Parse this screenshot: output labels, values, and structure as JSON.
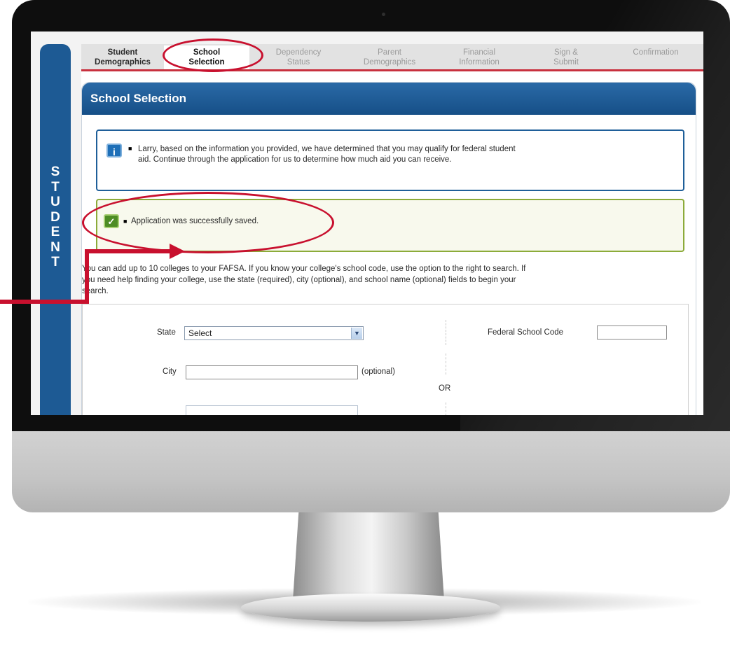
{
  "student_sidebar": {
    "letters": [
      "S",
      "T",
      "U",
      "D",
      "E",
      "N",
      "T"
    ]
  },
  "tabs": [
    {
      "line1": "Student",
      "line2": "Demographics",
      "state": "done"
    },
    {
      "line1": "School",
      "line2": "Selection",
      "state": "active"
    },
    {
      "line1": "Dependency",
      "line2": "Status",
      "state": "future"
    },
    {
      "line1": "Parent",
      "line2": "Demographics",
      "state": "future"
    },
    {
      "line1": "Financial",
      "line2": "Information",
      "state": "future"
    },
    {
      "line1": "Sign &",
      "line2": "Submit",
      "state": "future"
    },
    {
      "line1": "Confirmation",
      "line2": "",
      "state": "future"
    }
  ],
  "panel": {
    "title": "School Selection"
  },
  "info_message": {
    "icon": "info-icon",
    "line1": "Larry, based on the information you provided, we have determined that you may qualify for federal student",
    "line2": "aid. Continue through the application for us to determine how much aid you can receive."
  },
  "success_message": {
    "icon": "check-icon",
    "text": "Application was successfully saved."
  },
  "intro": {
    "line1": "You can add up to 10 colleges to your FAFSA. If you know your college's school code, use the option to the right to search. If",
    "line2": "you need help finding your college, use the state (required), city (optional), and school name (optional) fields to begin your",
    "line3": "search."
  },
  "search_form": {
    "state_label": "State",
    "state_value": "Select",
    "city_label": "City",
    "city_value": "",
    "optional_note": "(optional)",
    "or_label": "OR",
    "code_label": "Federal School Code",
    "code_value": ""
  },
  "colors": {
    "primary_blue": "#1d5a94",
    "tab_underline": "#c8303e",
    "annotation_red": "#c8102e",
    "success_green": "#8cab3a"
  }
}
